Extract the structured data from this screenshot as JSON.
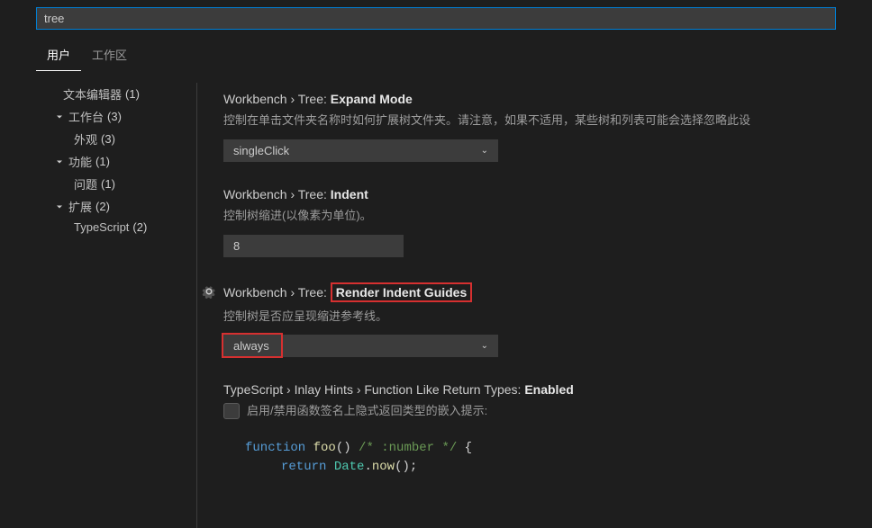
{
  "search": {
    "value": "tree"
  },
  "tabs": {
    "user": "用户",
    "workspace": "工作区"
  },
  "sidebar": {
    "items": [
      {
        "label": "文本编辑器",
        "count": "(1)",
        "level": 0,
        "chevron": false
      },
      {
        "label": "工作台",
        "count": "(3)",
        "level": 1,
        "chevron": true
      },
      {
        "label": "外观",
        "count": "(3)",
        "level": 2,
        "chevron": false
      },
      {
        "label": "功能",
        "count": "(1)",
        "level": 1,
        "chevron": true
      },
      {
        "label": "问题",
        "count": "(1)",
        "level": 2,
        "chevron": false
      },
      {
        "label": "扩展",
        "count": "(2)",
        "level": 1,
        "chevron": true
      },
      {
        "label": "TypeScript",
        "count": "(2)",
        "level": 2,
        "chevron": false
      }
    ]
  },
  "settings": {
    "expandMode": {
      "path": "Workbench › Tree: ",
      "title": "Expand Mode",
      "desc": "控制在单击文件夹名称时如何扩展树文件夹。请注意，如果不适用，某些树和列表可能会选择忽略此设",
      "value": "singleClick"
    },
    "indent": {
      "path": "Workbench › Tree: ",
      "title": "Indent",
      "desc": "控制树缩进(以像素为单位)。",
      "value": "8"
    },
    "renderIndentGuides": {
      "path": "Workbench › Tree: ",
      "title": "Render Indent Guides",
      "desc": "控制树是否应呈现缩进参考线。",
      "value": "always"
    },
    "functionReturnTypes": {
      "path": "TypeScript › Inlay Hints › Function Like Return Types: ",
      "title": "Enabled",
      "desc": "启用/禁用函数签名上隐式返回类型的嵌入提示:"
    }
  },
  "code": {
    "line1_kw": "function",
    "line1_fn": " foo",
    "line1_paren": "()",
    "line1_cmt": " /* :number */ ",
    "line1_brace": "{",
    "line2_kw": "return",
    "line2_dt": " Date",
    "line2_dot": ".",
    "line2_fn": "now",
    "line2_end": "();"
  }
}
